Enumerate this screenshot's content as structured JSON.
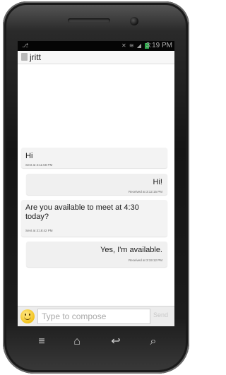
{
  "status_bar": {
    "time": "3:19 PM",
    "battery_color": "#2ea84b",
    "icons": [
      "usb-icon",
      "mute-icon",
      "wifi-icon",
      "signal-icon",
      "battery-icon"
    ]
  },
  "header": {
    "title": "jritt",
    "icon": "contact-icon"
  },
  "messages": [
    {
      "direction": "received",
      "text": "Hi",
      "meta": "Sent at 3:11:58 PM"
    },
    {
      "direction": "sent",
      "text": "Hi!",
      "meta": "Received at 3:12:15 PM"
    },
    {
      "direction": "received",
      "text": "Are you available to meet at 4:30 today?",
      "meta": "Sent at 3:18:42 PM"
    },
    {
      "direction": "sent",
      "text": "Yes, I'm available.",
      "meta": "Received at 3:19:12 PM"
    }
  ],
  "compose": {
    "placeholder": "Type to compose",
    "send_label": "Send",
    "emoji_icon": "smiley-icon"
  },
  "navbar": {
    "icons": [
      "menu-icon",
      "home-icon",
      "back-icon",
      "search-icon"
    ]
  }
}
